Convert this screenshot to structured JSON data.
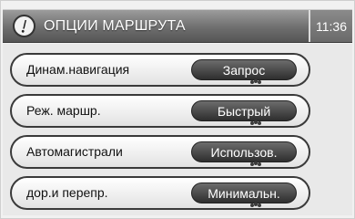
{
  "header": {
    "title": "ОПЦИИ МАРШРУТА",
    "time": "11:36"
  },
  "options": [
    {
      "label": "Динам.навигация",
      "value": "Запрос"
    },
    {
      "label": "Реж. маршр.",
      "value": "Быстрый"
    },
    {
      "label": "Автомагистрали",
      "value": "Использов."
    },
    {
      "label": "дор.и перепр.",
      "value": "Минимальн."
    }
  ],
  "icons": {
    "title_icon": "info-icon",
    "option_dots": "options-dots-icon"
  }
}
